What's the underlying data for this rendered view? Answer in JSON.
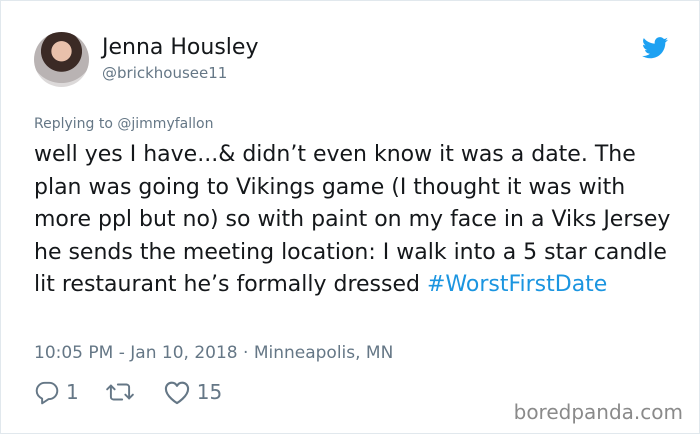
{
  "author": {
    "name": "Jenna Housley",
    "handle": "@brickhousee11"
  },
  "reply": {
    "prefix": "Replying to",
    "target": "@jimmyfallon"
  },
  "tweet": {
    "text": "well yes I have...& didn’t even know it was a date. The plan was going to Vikings game (I thought it was with more ppl but no) so with paint on my face in a Viks Jersey he sends the meeting location: I walk into a 5 star candle lit restaurant he’s formally dressed ",
    "hashtag": "#WorstFirstDate"
  },
  "meta": {
    "time": "10:05 PM",
    "date": "Jan 10, 2018",
    "location": "Minneapolis, MN",
    "separator_1": " - ",
    "separator_2": " · "
  },
  "actions": {
    "replies": "1",
    "retweets": "",
    "likes": "15",
    "reply_icon": "reply-icon",
    "retweet_icon": "retweet-icon",
    "like_icon": "heart-icon"
  },
  "brand": {
    "icon": "twitter-bird-icon",
    "color": "#1da1f2",
    "hashtag_color": "#1b95e0",
    "muted_color": "#657786"
  },
  "watermark": {
    "text": "boredpanda.com"
  }
}
